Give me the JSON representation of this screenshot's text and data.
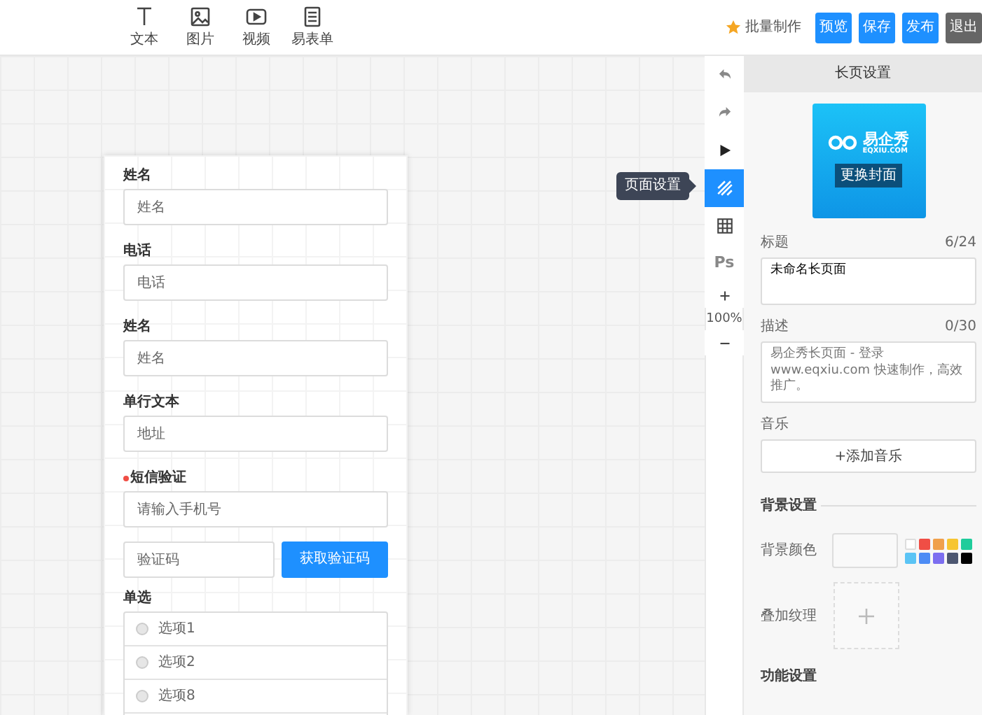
{
  "toolbar": {
    "tools": [
      {
        "kind": "text",
        "label": "文本"
      },
      {
        "kind": "image",
        "label": "图片"
      },
      {
        "kind": "video",
        "label": "视频"
      },
      {
        "kind": "form",
        "label": "易表单"
      }
    ],
    "batch": "批量制作",
    "buttons": [
      {
        "kind": "primary",
        "label": "预览"
      },
      {
        "kind": "primary",
        "label": "保存"
      },
      {
        "kind": "primary",
        "label": "发布"
      },
      {
        "kind": "dark",
        "label": "退出"
      }
    ]
  },
  "side_tools": {
    "items": [
      {
        "kind": "undo",
        "selected": false
      },
      {
        "kind": "redo",
        "selected": false
      },
      {
        "kind": "play",
        "selected": false
      },
      {
        "kind": "pattern",
        "selected": true
      },
      {
        "kind": "grid",
        "selected": false
      },
      {
        "kind": "ps",
        "text": "Ps",
        "selected": false
      },
      {
        "kind": "zoom_in",
        "selected": false
      },
      {
        "kind": "zoom_out",
        "selected": false
      }
    ],
    "zoom_level": "100%",
    "tooltip": "页面设置"
  },
  "form": {
    "fields": [
      {
        "kind": "input",
        "label": "姓名",
        "required": false,
        "placeholder": "姓名"
      },
      {
        "kind": "input",
        "label": "电话",
        "required": false,
        "placeholder": "电话"
      },
      {
        "kind": "input",
        "label": "姓名",
        "required": false,
        "placeholder": "姓名"
      },
      {
        "kind": "input",
        "label": "单行文本",
        "required": false,
        "placeholder": "地址"
      },
      {
        "kind": "sms",
        "label": "短信验证",
        "required": true,
        "placeholder": "请输入手机号",
        "code_placeholder": "验证码",
        "button": "获取验证码"
      },
      {
        "kind": "radio",
        "label": "单选",
        "required": false,
        "options": [
          {
            "label": "选项1",
            "selected": false
          },
          {
            "label": "选项2",
            "selected": false
          },
          {
            "label": "选项8",
            "selected": false
          }
        ]
      }
    ]
  },
  "panel": {
    "title": "长页设置",
    "cover": {
      "brand": "易企秀",
      "domain": "EQXIU.COM",
      "button": "更换封面"
    },
    "title_field": {
      "label": "标题",
      "count": "6/24",
      "value": "未命名长页面"
    },
    "description": {
      "label": "描述",
      "count": "0/30",
      "placeholder": "易企秀长页面 - 登录www.eqxiu.com 快速制作，高效推广。"
    },
    "music": {
      "label": "音乐",
      "button": "+添加音乐"
    },
    "background": {
      "heading": "背景设置",
      "color_label": "背景颜色",
      "swatches": [
        {
          "color": "#ffffff"
        },
        {
          "color": "#f04e45"
        },
        {
          "color": "#f0a04b"
        },
        {
          "color": "#f7c531"
        },
        {
          "color": "#1fcc9b"
        },
        {
          "color": "#5bc4f5"
        },
        {
          "color": "#4d8cf5"
        },
        {
          "color": "#7c6ef0"
        },
        {
          "color": "#4c5670"
        },
        {
          "color": "#000000"
        }
      ],
      "texture_label": "叠加纹理"
    },
    "function_heading": "功能设置"
  }
}
